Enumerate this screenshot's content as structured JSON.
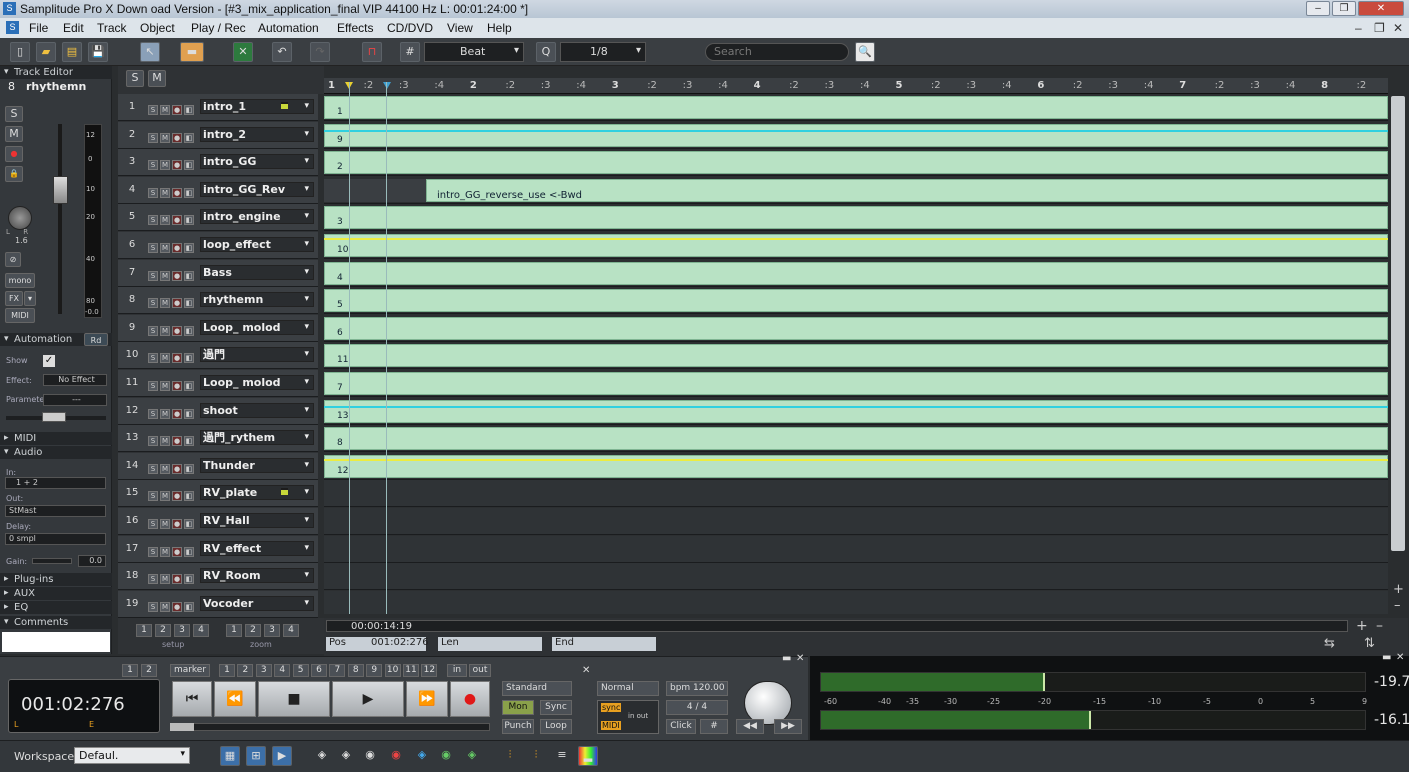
{
  "window": {
    "title": "Samplitude Pro X Down oad Version - [#3_mix_application_final VIP   44100 Hz L: 00:01:24:00 *]"
  },
  "menu": [
    "File",
    "Edit",
    "Track",
    "Object",
    "Play / Rec",
    "Automation",
    "Effects",
    "CD/DVD",
    "View",
    "Help"
  ],
  "toolbar": {
    "snap_mode": "Beat",
    "quantize": "1/8",
    "search_placeholder": "Search"
  },
  "track_editor": {
    "title": "Track Editor",
    "track_num": "8",
    "track_name": "rhythemn",
    "buttons": {
      "s": "S",
      "m": "M",
      "mono": "mono",
      "fx": "FX",
      "midi": "MIDI"
    },
    "pan_scale": "L      R",
    "pan_val": "1.6",
    "fader_scale": [
      "12",
      "0",
      "10",
      "20",
      "40",
      "80",
      "-0.0"
    ]
  },
  "automation": {
    "title": "Automation",
    "rd": "Rd",
    "show_label": "Show",
    "effect_label": "Effect:",
    "effect_value": "No Effect",
    "parameter_label": "Parameter",
    "parameter_value": "---"
  },
  "sections": {
    "midi": "MIDI",
    "audio": "Audio",
    "plugins": "Plug-ins",
    "aux": "AUX",
    "eq": "EQ",
    "comments": "Comments"
  },
  "audio": {
    "in_label": "In:",
    "in_value": "1 + 2",
    "out_label": "Out:",
    "out_value": "StMast",
    "delay_label": "Delay:",
    "delay_value": "0 smpl",
    "gain_label": "Gain:",
    "gain_value": "0.0"
  },
  "sm_header": {
    "s": "S",
    "m": "M"
  },
  "tracks": [
    {
      "num": "1",
      "name": "intro_1"
    },
    {
      "num": "2",
      "name": "intro_2"
    },
    {
      "num": "3",
      "name": "intro_GG"
    },
    {
      "num": "4",
      "name": "intro_GG_Rev"
    },
    {
      "num": "5",
      "name": "intro_engine"
    },
    {
      "num": "6",
      "name": "loop_effect"
    },
    {
      "num": "7",
      "name": "Bass"
    },
    {
      "num": "8",
      "name": "rhythemn"
    },
    {
      "num": "9",
      "name": "Loop_ molod"
    },
    {
      "num": "10",
      "name": "過門"
    },
    {
      "num": "11",
      "name": "Loop_ molod"
    },
    {
      "num": "12",
      "name": "shoot"
    },
    {
      "num": "13",
      "name": "過門_rythem"
    },
    {
      "num": "14",
      "name": "Thunder"
    },
    {
      "num": "15",
      "name": "RV_plate"
    },
    {
      "num": "16",
      "name": "RV_Hall"
    },
    {
      "num": "17",
      "name": "RV_effect"
    },
    {
      "num": "18",
      "name": "RV_Room"
    },
    {
      "num": "19",
      "name": "Vocoder"
    }
  ],
  "clip_numbers": [
    "1",
    "9",
    "2",
    "",
    "3",
    "10",
    "4",
    "5",
    "6",
    "11",
    "7",
    "13",
    "8",
    "12"
  ],
  "rev_clip_label": "intro_GG_reverse_use   <-Bwd",
  "ruler": [
    "1",
    ":2",
    ":3",
    ":4",
    "2",
    ":2",
    ":3",
    ":4",
    "3",
    ":2",
    ":3",
    ":4",
    "4",
    ":2",
    ":3",
    ":4",
    "5",
    ":2",
    ":3",
    ":4",
    "6",
    ":2",
    ":3",
    ":4",
    "7",
    ":2",
    ":3",
    ":4",
    "8",
    ":2"
  ],
  "setup": {
    "label": "setup",
    "nums": [
      "1",
      "2",
      "3",
      "4"
    ]
  },
  "zoom": {
    "label": "zoom",
    "nums": [
      "1",
      "2",
      "3",
      "4"
    ]
  },
  "position": {
    "time": "00:00:14:19",
    "pos_label": "Pos",
    "pos_value": "001:02:276",
    "len_label": "Len",
    "end_label": "End"
  },
  "transport": {
    "counter": "001:02:276",
    "counter_l": "L",
    "counter_e": "E",
    "marker_label": "marker",
    "marker_nums": [
      "1",
      "2",
      "3",
      "4",
      "5",
      "6",
      "7",
      "8",
      "9",
      "10",
      "11",
      "12"
    ],
    "left_nums": [
      "1",
      "2"
    ],
    "in_label": "in",
    "out_label": "out",
    "mode": "Standard",
    "mon": "Mon",
    "sync": "Sync",
    "punch": "Punch",
    "loop": "Loop",
    "speed": "Normal",
    "bpm": "bpm 120.00",
    "sig": "4 / 4",
    "click": "Click",
    "sync_small": "sync",
    "midi_small": "MIDI",
    "inout_small": "in out"
  },
  "meters": {
    "scale": [
      "-60",
      "-40",
      "-35",
      "-30",
      "-25",
      "-20",
      "-15",
      "-10",
      "-5",
      "0",
      "5",
      "9"
    ],
    "peak_top": "-19.7",
    "peak_bottom": "-16.1"
  },
  "workspace": {
    "label": "Workspace:",
    "value": "Defaul."
  }
}
